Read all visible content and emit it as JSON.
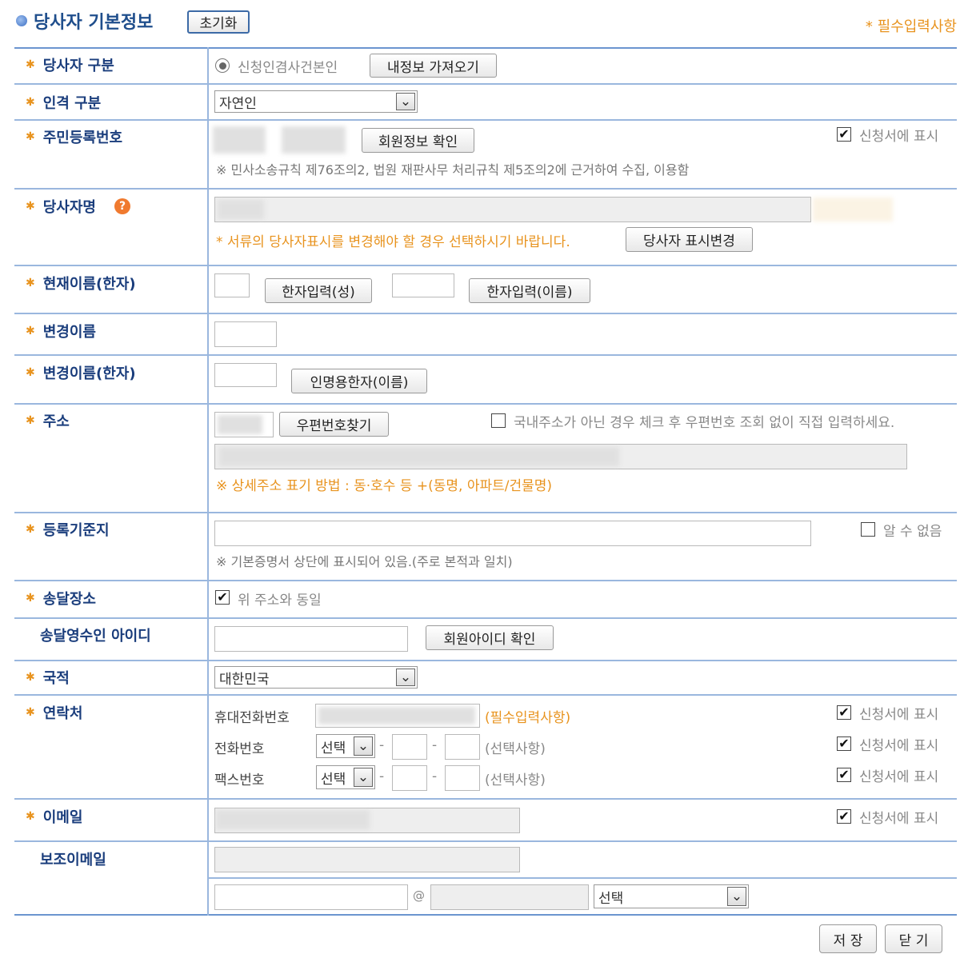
{
  "header": {
    "title": "당사자 기본정보",
    "reset_label": "초기화",
    "required_note": "* 필수입력사항"
  },
  "party_type": {
    "label": "당사자 구분",
    "radio_label": "신청인겸사건본인",
    "load_button": "내정보 가져오기"
  },
  "person_type": {
    "label": "인격 구분",
    "selected": "자연인"
  },
  "resident_no": {
    "label": "주민등록번호",
    "verify_button": "회원정보 확인",
    "show_label": "신청서에 표시",
    "note": "※ 민사소송규칙 제76조의2, 법원 재판사무 처리규칙 제5조의2에 근거하여 수집, 이용함"
  },
  "party_name": {
    "label": "당사자명",
    "help_icon": "?",
    "note": "* 서류의 당사자표시를 변경해야 할 경우 선택하시기 바랍니다.",
    "change_button": "당사자 표시변경"
  },
  "current_name_hanja": {
    "label": "현재이름(한자)",
    "surname_button": "한자입력(성)",
    "given_button": "한자입력(이름)"
  },
  "changed_name": {
    "label": "변경이름"
  },
  "changed_name_hanja": {
    "label": "변경이름(한자)",
    "button": "인명용한자(이름)"
  },
  "address": {
    "label": "주소",
    "postcode_button": "우편번호찾기",
    "foreign_check_label": "국내주소가 아닌 경우 체크 후 우편번호 조회 없이 직접 입력하세요.",
    "note": "※ 상세주소 표기 방법 : 동·호수 등 +(동명, 아파트/건물명)"
  },
  "registry_base": {
    "label": "등록기준지",
    "unknown_label": "알 수 없음",
    "note": "※ 기본증명서 상단에 표시되어 있음.(주로 본적과 일치)"
  },
  "delivery_place": {
    "label": "송달장소",
    "same_label": "위 주소와 동일"
  },
  "delivery_receiver": {
    "label": "송달영수인 아이디",
    "verify_button": "회원아이디 확인"
  },
  "nationality": {
    "label": "국적",
    "selected": "대한민국"
  },
  "contact": {
    "label": "연락처",
    "mobile_label": "휴대전화번호",
    "mobile_note": "(필수입력사항)",
    "phone_label": "전화번호",
    "fax_label": "팩스번호",
    "select_default": "선택",
    "dash": "-",
    "optional_note": "(선택사항)",
    "show_label": "신청서에 표시"
  },
  "email": {
    "label": "이메일",
    "show_label": "신청서에 표시"
  },
  "sub_email": {
    "label": "보조이메일",
    "at": "@",
    "domain_select": "선택"
  },
  "footer": {
    "save_label": "저 장",
    "close_label": "닫 기"
  }
}
